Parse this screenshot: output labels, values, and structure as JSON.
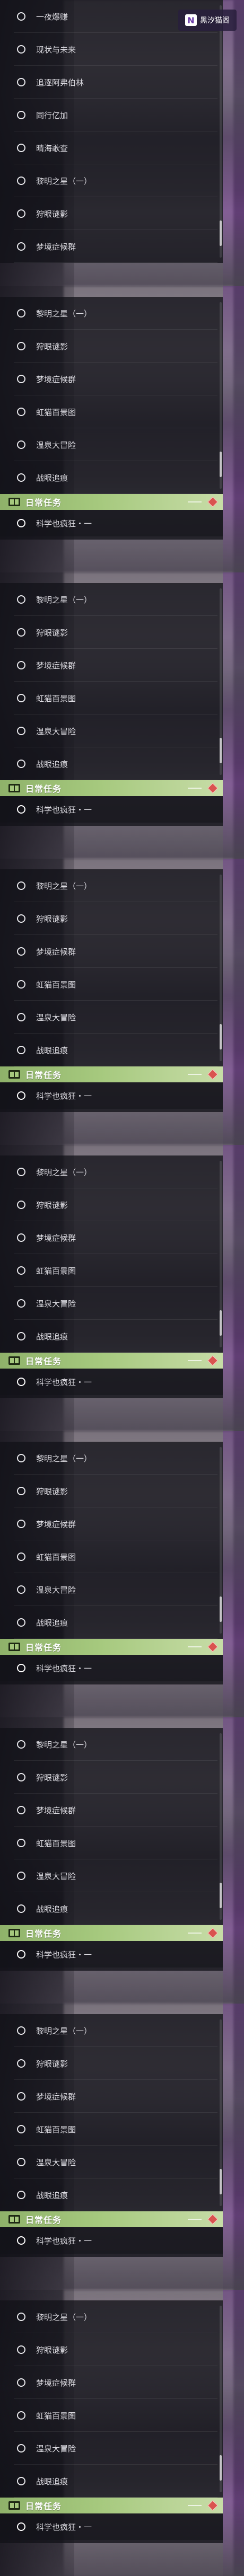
{
  "watermark": {
    "mark": "N",
    "text": "黑汐猫阁"
  },
  "panels": [
    {
      "items": [
        "一夜爆赚",
        "现状与未来",
        "追逐阿弗伯林",
        "同行亿加",
        "晴海歌查",
        "黎明之星（一）",
        "狩眼谜影",
        "梦境症候群"
      ],
      "daily": null
    },
    {
      "items": [
        "黎明之星（一）",
        "狩眼谜影",
        "梦境症候群",
        "虹猫百景图",
        "温泉大冒险",
        "战眼追痕"
      ],
      "daily": {
        "title": "日常任务",
        "items": [
          "科学也疯狂・一"
        ]
      }
    },
    {
      "items": [
        "黎明之星（一）",
        "狩眼谜影",
        "梦境症候群",
        "虹猫百景图",
        "温泉大冒险",
        "战眼追痕"
      ],
      "daily": {
        "title": "日常任务",
        "items": [
          "科学也疯狂・一"
        ]
      }
    },
    {
      "items": [
        "黎明之星（一）",
        "狩眼谜影",
        "梦境症候群",
        "虹猫百景图",
        "温泉大冒险",
        "战眼追痕"
      ],
      "daily": {
        "title": "日常任务",
        "items": [
          "科学也疯狂・一"
        ]
      }
    },
    {
      "items": [
        "黎明之星（一）",
        "狩眼谜影",
        "梦境症候群",
        "虹猫百景图",
        "温泉大冒险",
        "战眼追痕"
      ],
      "daily": {
        "title": "日常任务",
        "items": [
          "科学也疯狂・一"
        ]
      }
    },
    {
      "items": [
        "黎明之星（一）",
        "狩眼谜影",
        "梦境症候群",
        "虹猫百景图",
        "温泉大冒险",
        "战眼追痕"
      ],
      "daily": {
        "title": "日常任务",
        "items": [
          "科学也疯狂・一"
        ]
      }
    },
    {
      "items": [
        "黎明之星（一）",
        "狩眼谜影",
        "梦境症候群",
        "虹猫百景图",
        "温泉大冒险",
        "战眼追痕"
      ],
      "daily": {
        "title": "日常任务",
        "items": [
          "科学也疯狂・一"
        ]
      }
    },
    {
      "items": [
        "黎明之星（一）",
        "狩眼谜影",
        "梦境症候群",
        "虹猫百景图",
        "温泉大冒险",
        "战眼追痕"
      ],
      "daily": {
        "title": "日常任务",
        "items": [
          "科学也疯狂・一"
        ]
      }
    },
    {
      "items": [
        "黎明之星（一）",
        "狩眼谜影",
        "梦境症候群",
        "虹猫百景图",
        "温泉大冒险",
        "战眼追痕"
      ],
      "daily": {
        "title": "日常任务",
        "items": [
          "科学也疯狂・一"
        ]
      }
    }
  ],
  "colors": {
    "daily_header": "#a6c97e",
    "diamond": "#d9534f",
    "text": "#dedde3"
  },
  "icons": {
    "item": "circle-icon",
    "daily": "book-icon",
    "marker": "diamond-icon"
  }
}
